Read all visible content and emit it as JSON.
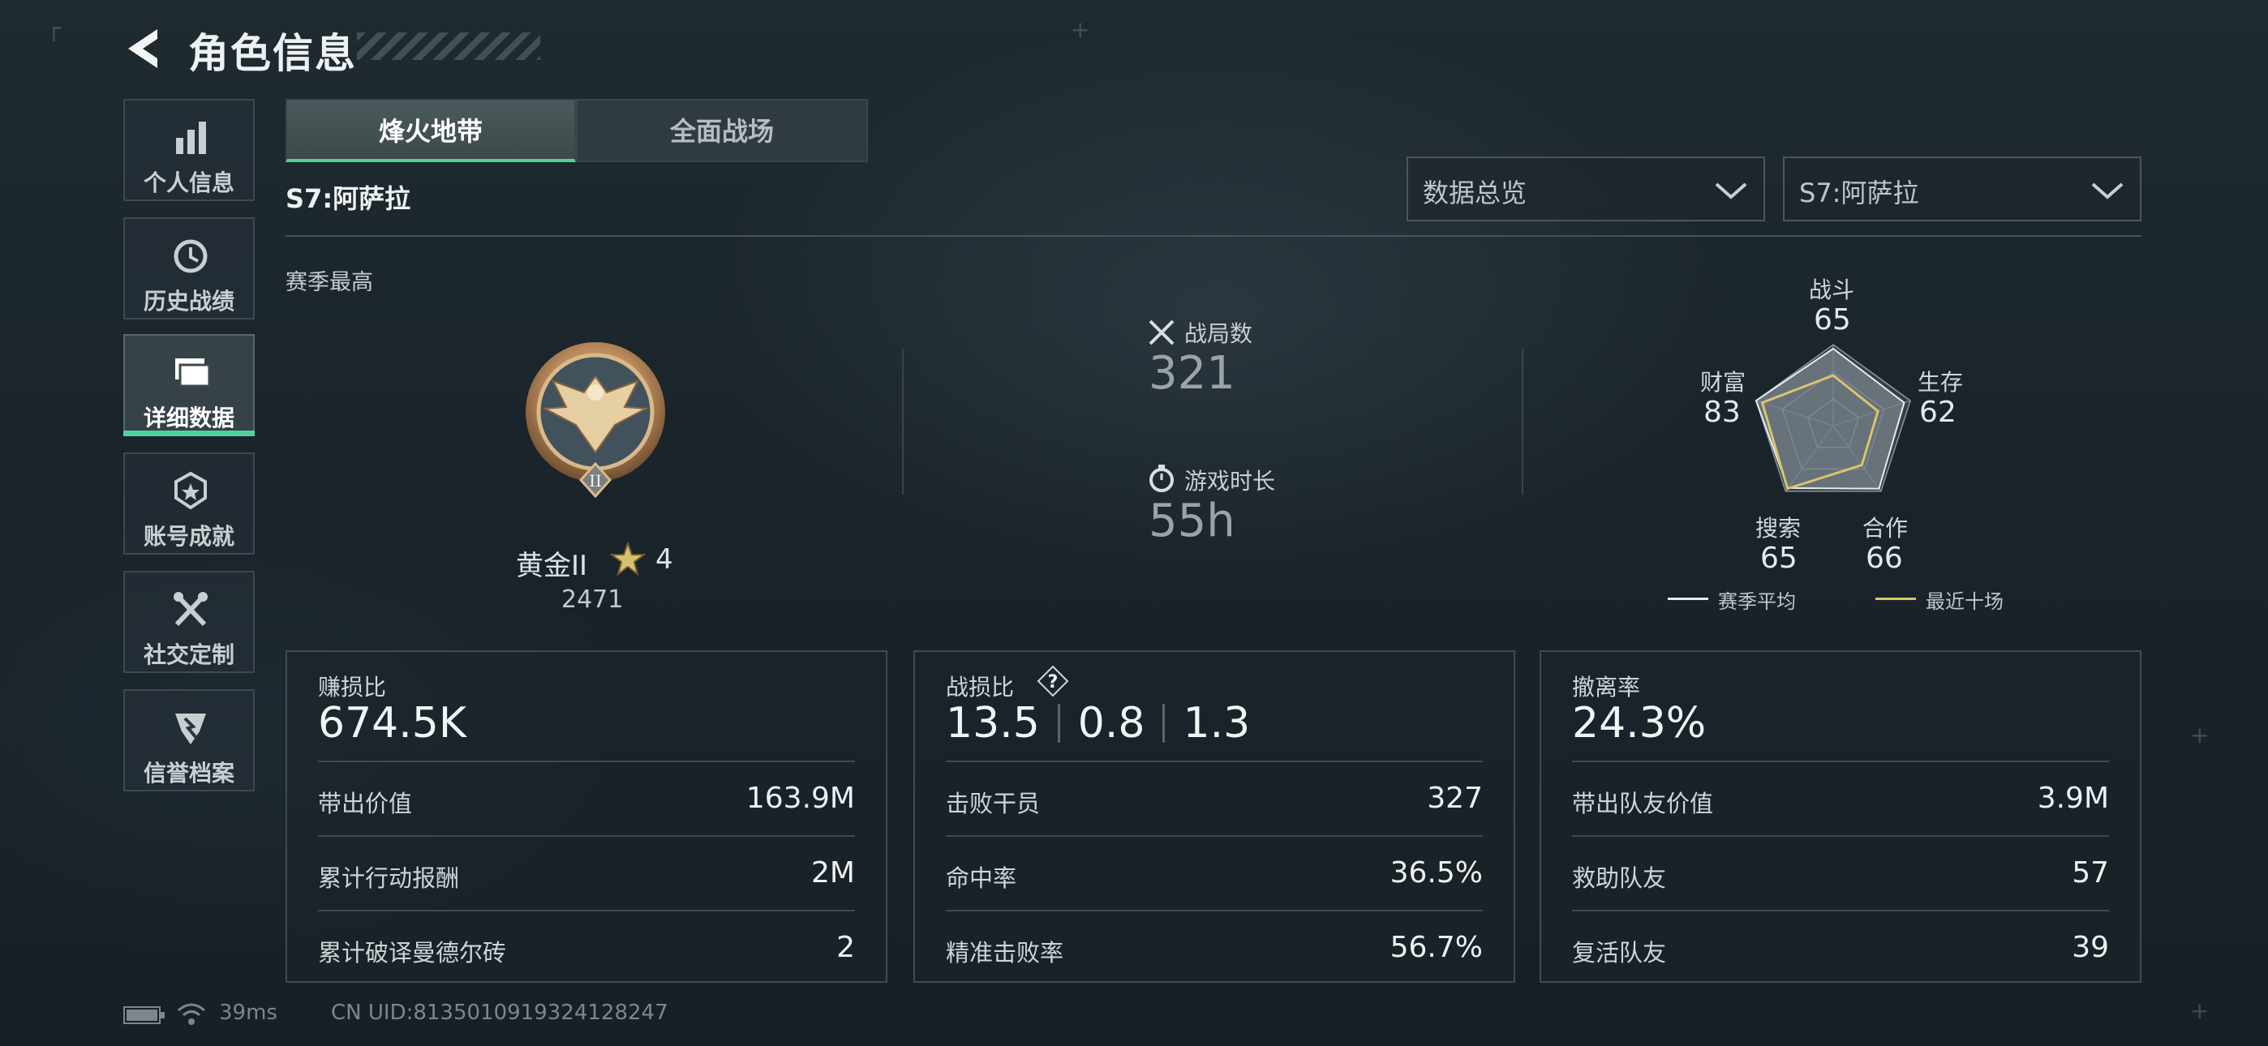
{
  "header": {
    "title": "角色信息"
  },
  "sidebar": {
    "items": [
      {
        "label": "个人信息",
        "icon": "bar-chart-icon"
      },
      {
        "label": "历史战绩",
        "icon": "history-icon"
      },
      {
        "label": "详细数据",
        "icon": "folders-icon",
        "active": true
      },
      {
        "label": "账号成就",
        "icon": "medal-icon"
      },
      {
        "label": "社交定制",
        "icon": "tools-icon"
      },
      {
        "label": "信誉档案",
        "icon": "credit-icon"
      }
    ]
  },
  "tabs": [
    {
      "label": "烽火地带",
      "active": true
    },
    {
      "label": "全面战场",
      "active": false
    }
  ],
  "season": {
    "label": "S7:阿萨拉"
  },
  "filters": {
    "view": {
      "selected": "数据总览"
    },
    "season": {
      "selected": "S7:阿萨拉"
    }
  },
  "rank": {
    "section_label": "赛季最高",
    "name": "黄金II",
    "stars": "4",
    "score": "2471",
    "medal_numeral": "II"
  },
  "stats": {
    "matches": {
      "label": "战局数",
      "value": "321"
    },
    "playtime": {
      "label": "游戏时长",
      "value": "55h"
    }
  },
  "radar": {
    "axes": [
      {
        "label": "战斗",
        "value": "65"
      },
      {
        "label": "生存",
        "value": "62"
      },
      {
        "label": "合作",
        "value": "66"
      },
      {
        "label": "搜索",
        "value": "65"
      },
      {
        "label": "财富",
        "value": "83"
      }
    ],
    "recent_values": [
      0.62,
      0.58,
      0.6,
      0.96,
      0.92
    ],
    "legend": [
      {
        "label": "赛季平均",
        "color": "#e8ecee"
      },
      {
        "label": "最近十场",
        "color": "#d9c46a"
      }
    ]
  },
  "cards": {
    "profit": {
      "title": "赚损比",
      "main": "674.5K",
      "rows": [
        {
          "label": "带出价值",
          "value": "163.9M"
        },
        {
          "label": "累计行动报酬",
          "value": "2M"
        },
        {
          "label": "累计破译曼德尔砖",
          "value": "2"
        }
      ]
    },
    "combat": {
      "title": "战损比",
      "help": "?",
      "kd": [
        "13.5",
        "0.8",
        "1.3"
      ],
      "rows": [
        {
          "label": "击败干员",
          "value": "327"
        },
        {
          "label": "命中率",
          "value": "36.5%"
        },
        {
          "label": "精准击败率",
          "value": "56.7%"
        }
      ]
    },
    "extract": {
      "title": "撤离率",
      "main": "24.3%",
      "rows": [
        {
          "label": "带出队友价值",
          "value": "3.9M"
        },
        {
          "label": "救助队友",
          "value": "57"
        },
        {
          "label": "复活队友",
          "value": "39"
        }
      ]
    }
  },
  "footer": {
    "ping": "39ms",
    "uid": "CN UID:8135010919324128247"
  },
  "colors": {
    "accent": "#4fd39a",
    "gold": "#d9c46a"
  }
}
